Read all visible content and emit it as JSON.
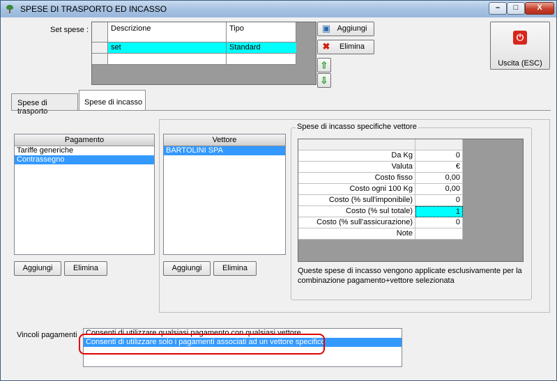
{
  "window": {
    "title": "SPESE DI TRASPORTO ED INCASSO",
    "min_label": "–",
    "max_label": "□",
    "close_label": "X"
  },
  "set_spese": {
    "label": "Set spese :",
    "columns": [
      "Descrizione",
      "Tipo"
    ],
    "rows": [
      {
        "descrizione": "set",
        "tipo": "Standard"
      }
    ]
  },
  "buttons": {
    "aggiungi": "Aggiungi",
    "elimina": "Elimina",
    "uscita": "Uscita (ESC)"
  },
  "tabs": [
    {
      "label": "Spese di trasporto"
    },
    {
      "label": "Spese di incasso"
    }
  ],
  "pagamento": {
    "header": "Pagamento",
    "items": [
      "Tariffe generiche",
      "Contrassegno"
    ],
    "selected": 1
  },
  "vettore": {
    "header": "Vettore",
    "items": [
      "BARTOLINI SPA"
    ],
    "selected": 0
  },
  "incasso": {
    "group_title": "Spese di incasso specifiche vettore",
    "rows": [
      {
        "label": "Da Kg",
        "value": "0"
      },
      {
        "label": "Valuta",
        "value": "€"
      },
      {
        "label": "Costo fisso",
        "value": "0,00"
      },
      {
        "label": "Costo ogni 100 Kg",
        "value": "0,00"
      },
      {
        "label": "Costo (% sull'imponibile)",
        "value": "0"
      },
      {
        "label": "Costo (% sul totale)",
        "value": "1"
      },
      {
        "label": "Costo (% sull'assicurazione)",
        "value": "0"
      },
      {
        "label": "Note",
        "value": ""
      }
    ],
    "note": "Queste spese di incasso vengono applicate esclusivamente per la combinazione pagamento+vettore selezionata"
  },
  "vincoli": {
    "label": "Vincoli pagamenti",
    "options": [
      "Consenti di utilizzare qualsiasi pagamento con qualsiasi vettore",
      "Consenti di utilizzare solo i pagamenti associati ad un vettore specifico"
    ],
    "selected": 1
  },
  "colors": {
    "selection_cyan": "#00ffff",
    "selection_blue": "#3399ff",
    "highlight_red": "#e00000"
  }
}
